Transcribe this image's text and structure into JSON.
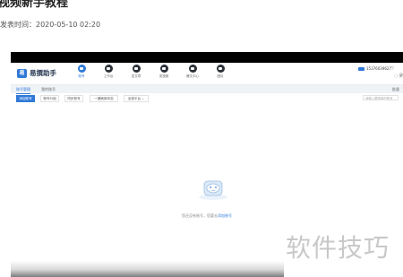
{
  "article": {
    "title": "视频新手教程",
    "meta_label": "发表时间：",
    "meta_date": "2020-05-10 02:20"
  },
  "app": {
    "logo_mark": "易",
    "name": "易撰助手",
    "nav": [
      {
        "label": "账号",
        "active": true
      },
      {
        "label": "工作台",
        "active": false
      },
      {
        "label": "发文章",
        "active": false
      },
      {
        "label": "发视频",
        "active": false
      },
      {
        "label": "爆文中心",
        "active": false
      },
      {
        "label": "团队",
        "active": false
      }
    ],
    "phone": "15376039627",
    "chevron": "▽",
    "refresh": "◌ 刷"
  },
  "subtabs": {
    "items": [
      "账号管理",
      "我的账号"
    ],
    "batch": "批量"
  },
  "toolbar": {
    "buttons": [
      "添加账号",
      "账号分组",
      "同步账号",
      "一键刷新状态",
      "全部平台 ⌄"
    ],
    "search_placeholder": "请输入要搜索的账号"
  },
  "empty_state": {
    "text": "您还没有账号，您要去",
    "link": "添加账号"
  },
  "watermark": "软件技巧",
  "colors": {
    "accent": "#2f79d8",
    "nav_icon": "#2b2f38",
    "top_strip": "#000000"
  }
}
